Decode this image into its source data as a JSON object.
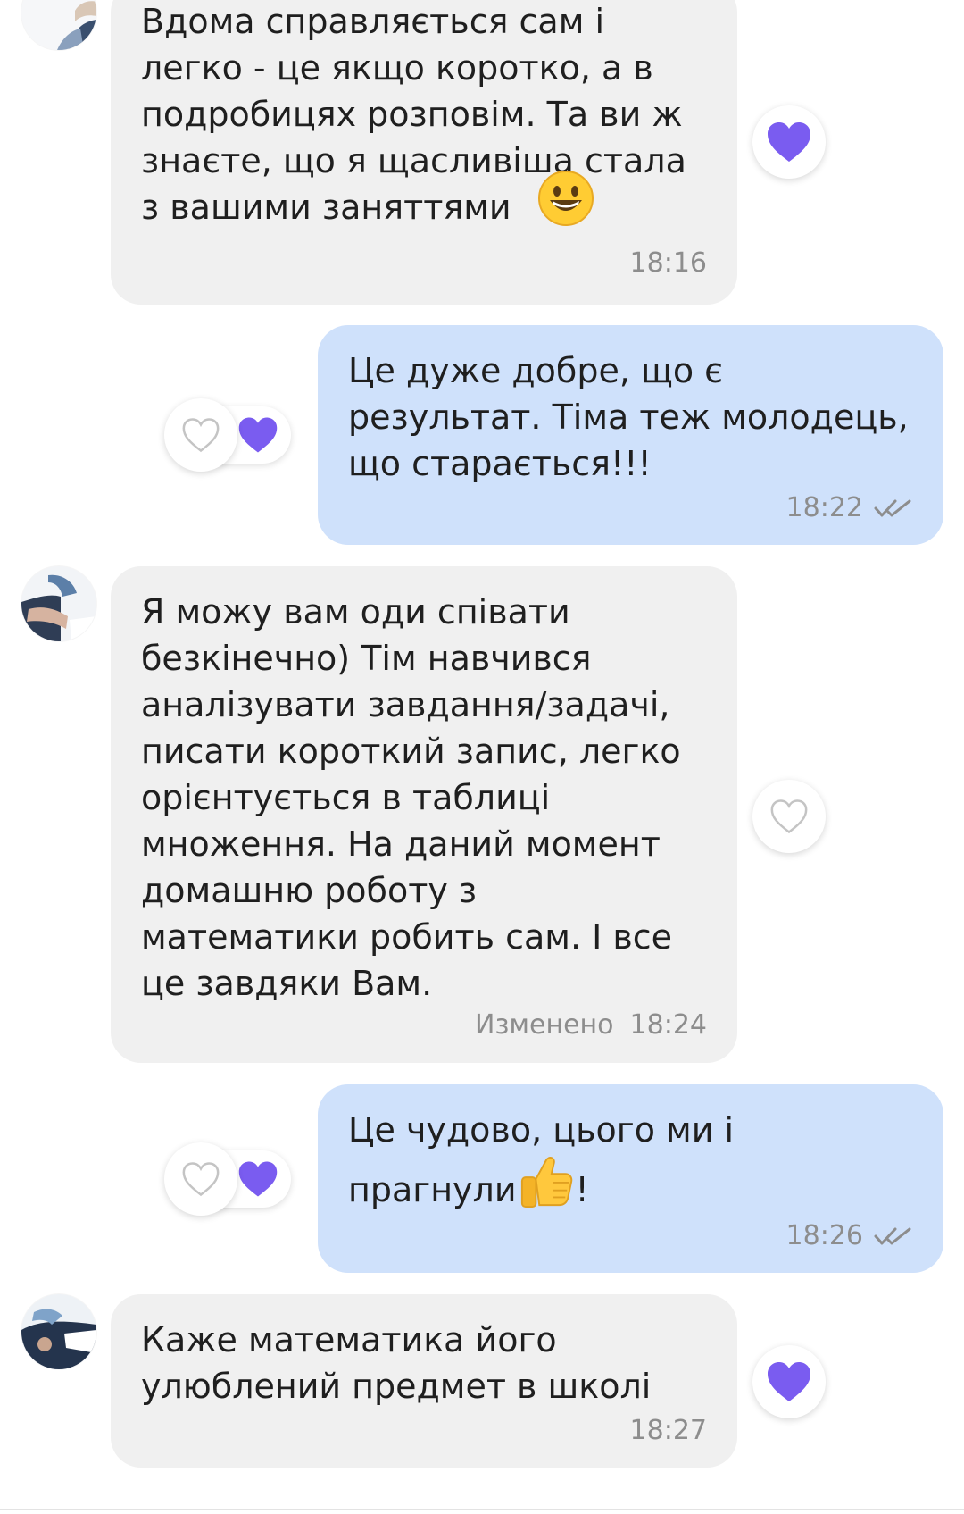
{
  "messages": [
    {
      "text": "Вдома справляється сам і\nлегко - це якщо коротко, а в\nподробицях розповім. Та ви ж\nзнаєте, що я щасливіша стала\nз вашими заняттями",
      "time": "18:16"
    },
    {
      "text": "Це дуже добре, що є\nрезультат. Тіма теж молодець,\nщо старається!!!",
      "time": "18:22"
    },
    {
      "text": "Я можу вам оди співати\nбезкінечно) Тім навчився\nаналізувати завдання/задачі,\nписати короткий запис, легко\nорієнтується в таблиці\nмноження. На даний момент\nдомашню роботу з\nматематики робить сам. І все\nце завдяки Вам.",
      "edited_label": "Изменено",
      "time": "18:24"
    },
    {
      "text_before": "Це чудово, цього ми і\nпрагнули",
      "text_after": "!",
      "time": "18:26"
    },
    {
      "text": "Каже математика його\nулюблений предмет в школі",
      "time": "18:27"
    }
  ],
  "colors": {
    "incoming_bg": "#f0f0f0",
    "outgoing_bg": "#cfe1fb",
    "heart_filled": "#7a5cf0",
    "heart_outline": "#c4c4c4",
    "meta_text": "#8d8d8d"
  },
  "icons": {
    "grin_emoji": "grinning-face-emoji",
    "thumbs_up_emoji": "thumbs-up-emoji",
    "read_receipt": "double-check-icon"
  }
}
